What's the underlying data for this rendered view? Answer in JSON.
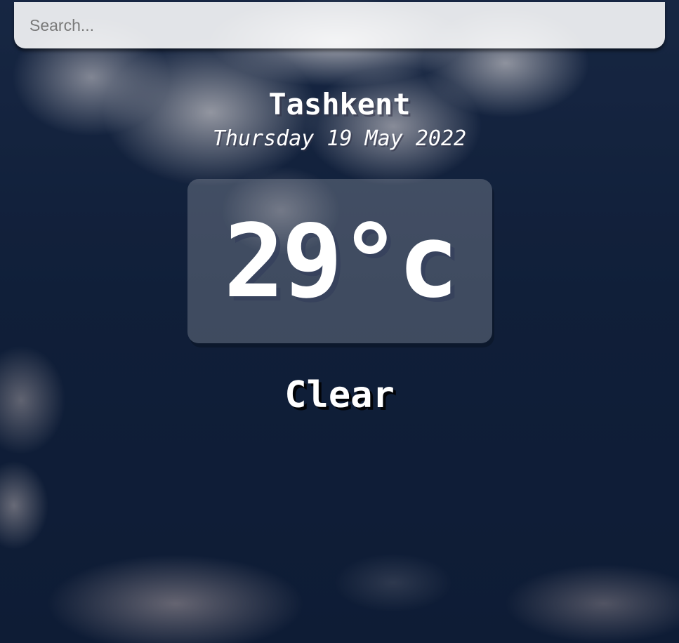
{
  "search": {
    "placeholder": "Search...",
    "value": ""
  },
  "location": {
    "city": "Tashkent",
    "date": "Thursday 19 May 2022"
  },
  "weather": {
    "temperature": "29°c",
    "condition": "Clear"
  },
  "colors": {
    "text": "#ffffff",
    "sky_dark": "#12233f",
    "search_bg": "#eeeeee"
  }
}
